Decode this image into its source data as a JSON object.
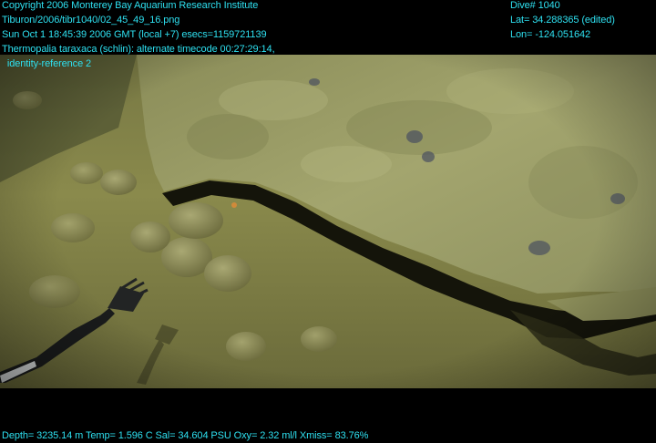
{
  "overlay": {
    "top_left": [
      "Copyright 2006 Monterey Bay Aquarium Research Institute",
      "Tiburon/2006/tibr1040/02_45_49_16.png",
      "Sun Oct  1 18:45:39 2006 GMT (local +7)  esecs=1159721139",
      "Thermopalia taraxaca (schlin): alternate timecode 00:27:29:14,",
      "  identity-reference 2"
    ],
    "top_right": [
      "Dive# 1040",
      "Lat= 34.288365 (edited)",
      "Lon= -124.051642"
    ],
    "bottom": "Depth= 3235.14 m  Temp= 1.596 C  Sal= 34.604 PSU  Oxy= 2.32 ml/l  Xmiss= 83.76%"
  },
  "colors": {
    "overlay_text": "#2ee0f0",
    "background": "#000000",
    "seafloor": "#8a8a4a",
    "rock_slab": "#9ea06a",
    "crevice": "#141408"
  }
}
